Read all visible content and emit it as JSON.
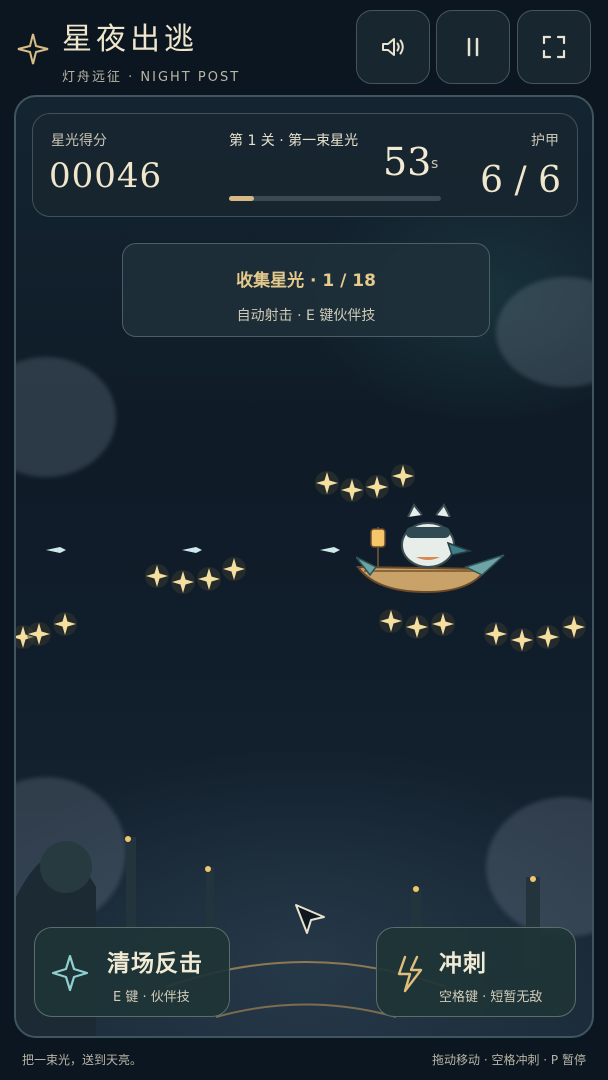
{
  "header": {
    "title": "星夜出逃",
    "subtitle": "灯舟远征 · NIGHT POST",
    "buttons": [
      {
        "icon": "speaker-icon"
      },
      {
        "icon": "pause-icon"
      },
      {
        "icon": "fullscreen-icon"
      }
    ]
  },
  "hud": {
    "score_label": "星光得分",
    "score": "00046",
    "level_text": "第 1 关 · 第一束星光",
    "time": "53",
    "time_unit": "s",
    "progress": 0.12,
    "armor_label": "护甲",
    "armor": "6 / 6"
  },
  "objective": {
    "title": "收集星光 · 1 / 18",
    "hint": "自动射击 · E 键伙伴技"
  },
  "actions": {
    "clear": {
      "title": "清场反击",
      "hint": "E 键 · 伙伴技",
      "icon": "star-icon"
    },
    "dash": {
      "title": "冲刺",
      "hint": "空格键 · 短暂无敌",
      "icon": "lightning-icon"
    }
  },
  "footer": {
    "left": "把一束光，送到天亮。",
    "right": "拖动移动 · 空格冲刺 · P 暂停"
  },
  "colors": {
    "accent_gold": "#d6b985",
    "background": "#0b1620",
    "panel": "#18262f"
  }
}
